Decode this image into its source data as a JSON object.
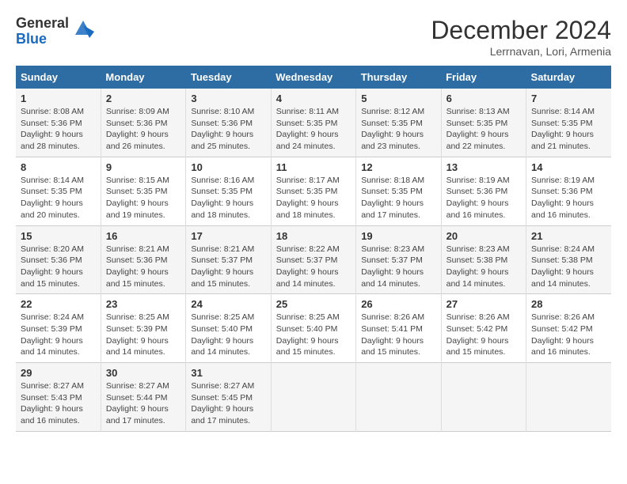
{
  "logo": {
    "general": "General",
    "blue": "Blue"
  },
  "title": "December 2024",
  "subtitle": "Lerrnavan, Lori, Armenia",
  "days_of_week": [
    "Sunday",
    "Monday",
    "Tuesday",
    "Wednesday",
    "Thursday",
    "Friday",
    "Saturday"
  ],
  "weeks": [
    [
      {
        "day": 1,
        "sunrise": "8:08 AM",
        "sunset": "5:36 PM",
        "daylight": "9 hours and 28 minutes."
      },
      {
        "day": 2,
        "sunrise": "8:09 AM",
        "sunset": "5:36 PM",
        "daylight": "9 hours and 26 minutes."
      },
      {
        "day": 3,
        "sunrise": "8:10 AM",
        "sunset": "5:36 PM",
        "daylight": "9 hours and 25 minutes."
      },
      {
        "day": 4,
        "sunrise": "8:11 AM",
        "sunset": "5:35 PM",
        "daylight": "9 hours and 24 minutes."
      },
      {
        "day": 5,
        "sunrise": "8:12 AM",
        "sunset": "5:35 PM",
        "daylight": "9 hours and 23 minutes."
      },
      {
        "day": 6,
        "sunrise": "8:13 AM",
        "sunset": "5:35 PM",
        "daylight": "9 hours and 22 minutes."
      },
      {
        "day": 7,
        "sunrise": "8:14 AM",
        "sunset": "5:35 PM",
        "daylight": "9 hours and 21 minutes."
      }
    ],
    [
      {
        "day": 8,
        "sunrise": "8:14 AM",
        "sunset": "5:35 PM",
        "daylight": "9 hours and 20 minutes."
      },
      {
        "day": 9,
        "sunrise": "8:15 AM",
        "sunset": "5:35 PM",
        "daylight": "9 hours and 19 minutes."
      },
      {
        "day": 10,
        "sunrise": "8:16 AM",
        "sunset": "5:35 PM",
        "daylight": "9 hours and 18 minutes."
      },
      {
        "day": 11,
        "sunrise": "8:17 AM",
        "sunset": "5:35 PM",
        "daylight": "9 hours and 18 minutes."
      },
      {
        "day": 12,
        "sunrise": "8:18 AM",
        "sunset": "5:35 PM",
        "daylight": "9 hours and 17 minutes."
      },
      {
        "day": 13,
        "sunrise": "8:19 AM",
        "sunset": "5:36 PM",
        "daylight": "9 hours and 16 minutes."
      },
      {
        "day": 14,
        "sunrise": "8:19 AM",
        "sunset": "5:36 PM",
        "daylight": "9 hours and 16 minutes."
      }
    ],
    [
      {
        "day": 15,
        "sunrise": "8:20 AM",
        "sunset": "5:36 PM",
        "daylight": "9 hours and 15 minutes."
      },
      {
        "day": 16,
        "sunrise": "8:21 AM",
        "sunset": "5:36 PM",
        "daylight": "9 hours and 15 minutes."
      },
      {
        "day": 17,
        "sunrise": "8:21 AM",
        "sunset": "5:37 PM",
        "daylight": "9 hours and 15 minutes."
      },
      {
        "day": 18,
        "sunrise": "8:22 AM",
        "sunset": "5:37 PM",
        "daylight": "9 hours and 14 minutes."
      },
      {
        "day": 19,
        "sunrise": "8:23 AM",
        "sunset": "5:37 PM",
        "daylight": "9 hours and 14 minutes."
      },
      {
        "day": 20,
        "sunrise": "8:23 AM",
        "sunset": "5:38 PM",
        "daylight": "9 hours and 14 minutes."
      },
      {
        "day": 21,
        "sunrise": "8:24 AM",
        "sunset": "5:38 PM",
        "daylight": "9 hours and 14 minutes."
      }
    ],
    [
      {
        "day": 22,
        "sunrise": "8:24 AM",
        "sunset": "5:39 PM",
        "daylight": "9 hours and 14 minutes."
      },
      {
        "day": 23,
        "sunrise": "8:25 AM",
        "sunset": "5:39 PM",
        "daylight": "9 hours and 14 minutes."
      },
      {
        "day": 24,
        "sunrise": "8:25 AM",
        "sunset": "5:40 PM",
        "daylight": "9 hours and 14 minutes."
      },
      {
        "day": 25,
        "sunrise": "8:25 AM",
        "sunset": "5:40 PM",
        "daylight": "9 hours and 15 minutes."
      },
      {
        "day": 26,
        "sunrise": "8:26 AM",
        "sunset": "5:41 PM",
        "daylight": "9 hours and 15 minutes."
      },
      {
        "day": 27,
        "sunrise": "8:26 AM",
        "sunset": "5:42 PM",
        "daylight": "9 hours and 15 minutes."
      },
      {
        "day": 28,
        "sunrise": "8:26 AM",
        "sunset": "5:42 PM",
        "daylight": "9 hours and 16 minutes."
      }
    ],
    [
      {
        "day": 29,
        "sunrise": "8:27 AM",
        "sunset": "5:43 PM",
        "daylight": "9 hours and 16 minutes."
      },
      {
        "day": 30,
        "sunrise": "8:27 AM",
        "sunset": "5:44 PM",
        "daylight": "9 hours and 17 minutes."
      },
      {
        "day": 31,
        "sunrise": "8:27 AM",
        "sunset": "5:45 PM",
        "daylight": "9 hours and 17 minutes."
      },
      null,
      null,
      null,
      null
    ]
  ]
}
